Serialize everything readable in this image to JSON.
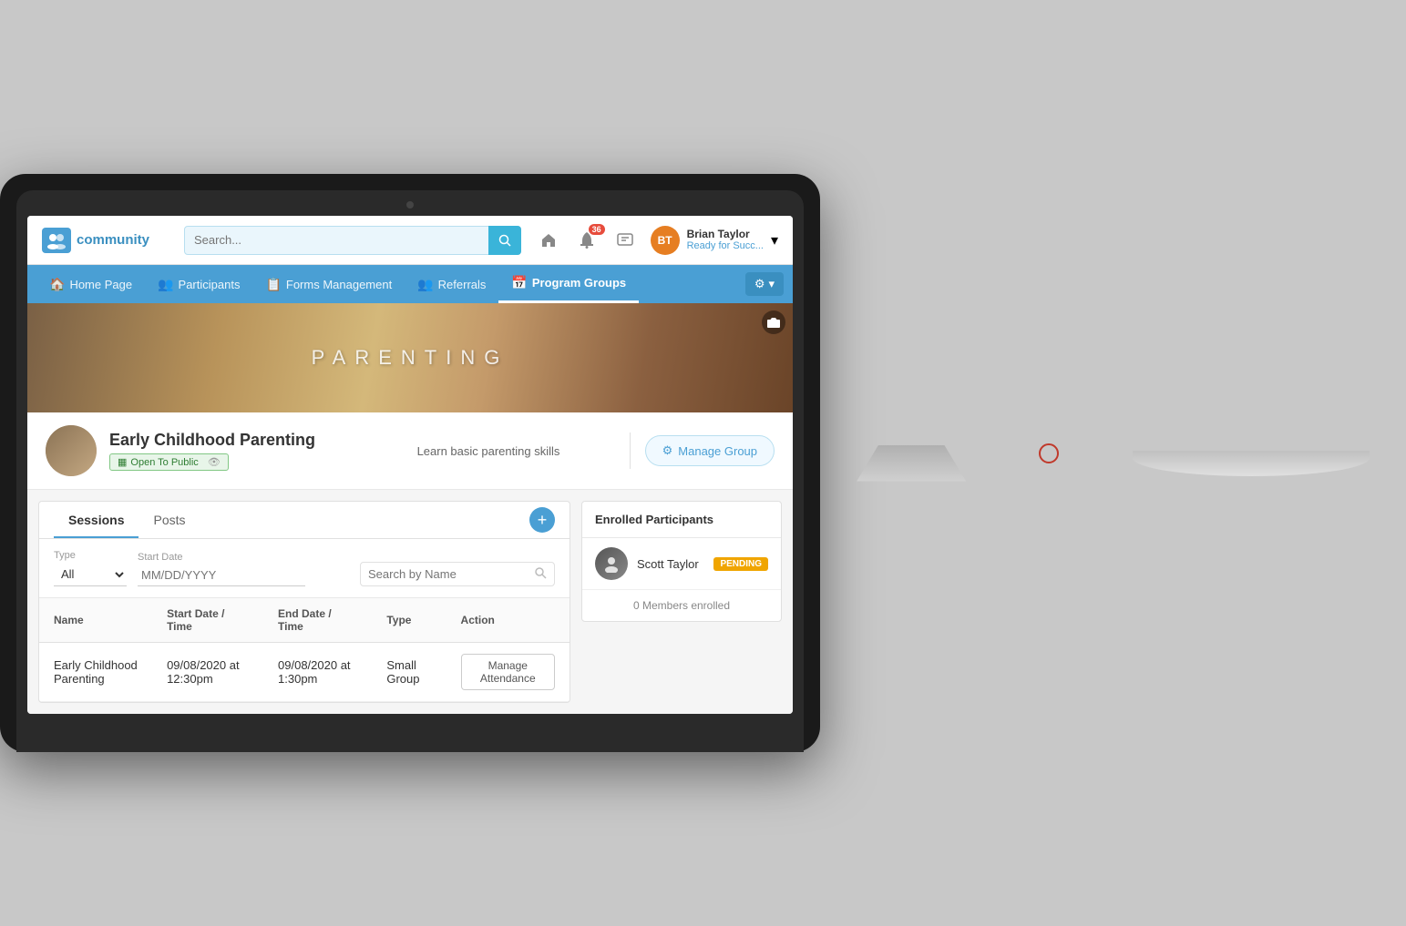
{
  "monitor": {
    "camera_label": "camera"
  },
  "header": {
    "logo_text": "community",
    "logo_icon": "👥",
    "search_placeholder": "Search...",
    "search_btn_label": "🔍",
    "home_icon": "🏠",
    "notification_icon": "🔔",
    "notification_count": "36",
    "message_icon": "💬",
    "user_initials": "BT",
    "user_name": "Brian Taylor",
    "user_status": "Ready for Succ...",
    "dropdown_icon": "▼"
  },
  "nav": {
    "items": [
      {
        "label": "Home Page",
        "icon": "🏠",
        "active": false
      },
      {
        "label": "Participants",
        "icon": "👥",
        "active": false
      },
      {
        "label": "Forms Management",
        "icon": "📋",
        "active": false
      },
      {
        "label": "Referrals",
        "icon": "👥",
        "active": false
      },
      {
        "label": "Program Groups",
        "icon": "📅",
        "active": true
      }
    ],
    "settings_icon": "⚙",
    "settings_label": "⚙ ▼"
  },
  "hero": {
    "text": "PARENTING",
    "camera_icon": "📷"
  },
  "group": {
    "name": "Early Childhood Parenting",
    "badge": "Open To Public",
    "description": "Learn basic parenting skills",
    "manage_btn": "Manage Group",
    "manage_icon": "⚙"
  },
  "tabs": {
    "sessions_label": "Sessions",
    "posts_label": "Posts",
    "add_icon": "+"
  },
  "filters": {
    "type_label": "Type",
    "type_value": "All",
    "date_label": "Start Date",
    "date_placeholder": "MM/DD/YYYY",
    "search_placeholder": "Search by Name"
  },
  "table": {
    "columns": [
      "Name",
      "Start Date / Time",
      "End Date / Time",
      "Type",
      "Action"
    ],
    "rows": [
      {
        "name": "Early Childhood Parenting",
        "start": "09/08/2020 at 12:30pm",
        "end": "09/08/2020 at 1:30pm",
        "type": "Small Group",
        "action": "Manage Attendance"
      }
    ]
  },
  "enrolled": {
    "header": "Enrolled Participants",
    "participants": [
      {
        "name": "Scott Taylor",
        "status": "PENDING",
        "avatar_icon": "👤"
      }
    ],
    "count_label": "0 Members enrolled"
  }
}
